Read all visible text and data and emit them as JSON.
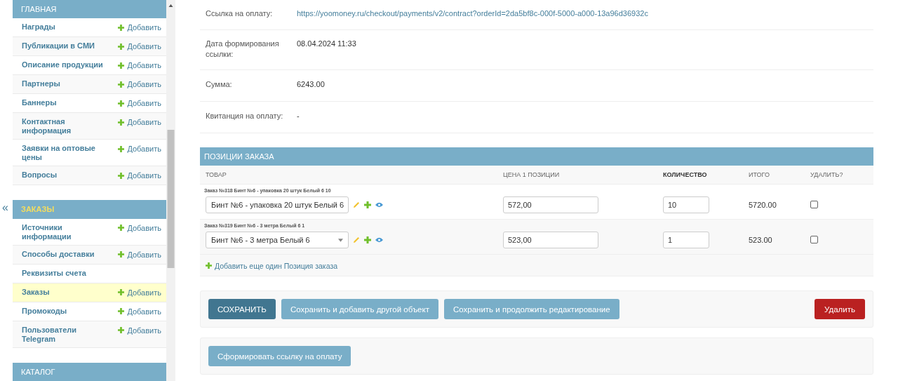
{
  "sidebar": {
    "collapse_toggle": "«",
    "sections": [
      {
        "title": "ГЛАВНАЯ",
        "selected": false,
        "items": [
          {
            "label": "Награды",
            "add": "Добавить",
            "selected": false
          },
          {
            "label": "Публикации в СМИ",
            "add": "Добавить",
            "selected": false
          },
          {
            "label": "Описание продукции",
            "add": "Добавить",
            "selected": false
          },
          {
            "label": "Партнеры",
            "add": "Добавить",
            "selected": false
          },
          {
            "label": "Баннеры",
            "add": "Добавить",
            "selected": false
          },
          {
            "label": "Контактная информация",
            "add": "Добавить",
            "selected": false
          },
          {
            "label": "Заявки на оптовые цены",
            "add": "Добавить",
            "selected": false
          },
          {
            "label": "Вопросы",
            "add": "Добавить",
            "selected": false
          }
        ]
      },
      {
        "title": "ЗАКАЗЫ",
        "selected": true,
        "items": [
          {
            "label": "Источники информации",
            "add": "Добавить",
            "selected": false
          },
          {
            "label": "Способы доставки",
            "add": "Добавить",
            "selected": false
          },
          {
            "label": "Реквизиты счета",
            "selected": false
          },
          {
            "label": "Заказы",
            "add": "Добавить",
            "selected": true
          },
          {
            "label": "Промокоды",
            "add": "Добавить",
            "selected": false
          },
          {
            "label": "Пользователи Telegram",
            "add": "Добавить",
            "selected": false
          }
        ]
      },
      {
        "title": "КАТАЛОГ",
        "selected": false
      }
    ]
  },
  "fields": [
    {
      "label": "Ссылка на оплату:",
      "value": "https://yoomoney.ru/checkout/payments/v2/contract?orderId=2da5bf8c-000f-5000-a000-13a96d36932c",
      "kind": "link"
    },
    {
      "label": "Дата формирования ссылки:",
      "value": "08.04.2024 11:33",
      "kind": "text"
    },
    {
      "label": "Сумма:",
      "value": "6243.00",
      "kind": "text"
    },
    {
      "label": "Квитанция на оплату:",
      "value": "-",
      "kind": "text"
    }
  ],
  "order_items": {
    "title": "ПОЗИЦИИ ЗАКАЗА",
    "columns": [
      {
        "label": "ТОВАР",
        "bold": false
      },
      {
        "label": "ЦЕНА 1 ПОЗИЦИИ",
        "bold": false
      },
      {
        "label": "КОЛИЧЕСТВО",
        "bold": true
      },
      {
        "label": "ИТОГО",
        "bold": false
      },
      {
        "label": "УДАЛИТЬ?",
        "bold": false
      }
    ],
    "rows": [
      {
        "caption": "Заказ №318 Бинт №6 - упаковка 20 штук Белый 6 10",
        "product": "Бинт №6 - упаковка 20 штук Белый 6",
        "price": "572,00",
        "quantity": "10",
        "total": "5720.00",
        "delete": false
      },
      {
        "caption": "Заказ №319 Бинт №6 - 3 метра Белый 6 1",
        "product": "Бинт №6 - 3 метра Белый 6",
        "price": "523,00",
        "quantity": "1",
        "total": "523.00",
        "delete": false
      }
    ],
    "add_link": "Добавить еще один Позиция заказа"
  },
  "actions": [
    {
      "label": "СОХРАНИТЬ",
      "kind": "primary"
    },
    {
      "label": "Сохранить и добавить другой объект",
      "kind": "secondary"
    },
    {
      "label": "Сохранить и продолжить редактирование",
      "kind": "secondary"
    },
    {
      "label": "Удалить",
      "kind": "danger"
    }
  ],
  "extra_actions": [
    {
      "label": "Сформировать ссылку на оплату",
      "kind": "secondary"
    }
  ]
}
